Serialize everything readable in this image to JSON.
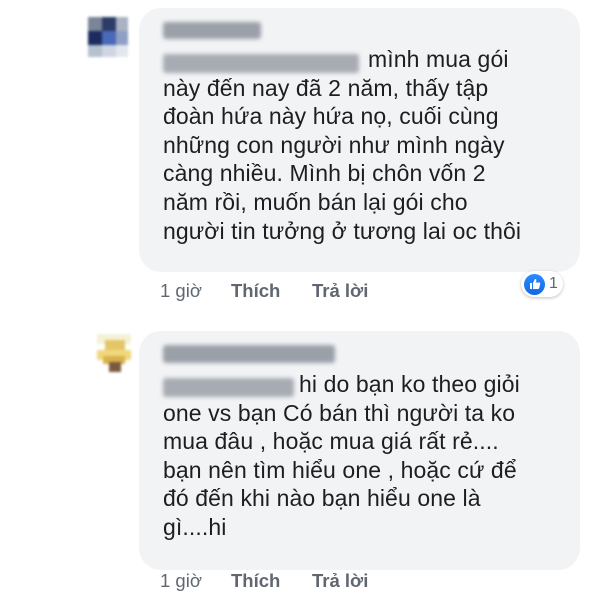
{
  "comments": [
    {
      "lines": [
        "mình mua gói",
        "này đến nay đã 2 năm, thấy tập",
        "đoàn hứa này hứa nọ, cuối cùng",
        "những con người như mình ngày",
        "càng nhiều. Mình bị chôn vốn 2",
        "năm rồi, muốn bán lại gói cho",
        "người tin tưởng ở tương lai oc thôi"
      ],
      "time": "1 giờ",
      "like_label": "Thích",
      "reply_label": "Trả lời",
      "reaction_count": "1",
      "reaction_icon": "like-icon",
      "colors": {
        "like": "#1877f2"
      }
    },
    {
      "lines": [
        "hi do bạn ko theo giỏi",
        "one vs bạn Có bán thì người ta ko",
        "mua đâu , hoặc mua giá rất rẻ....",
        "bạn nên tìm hiểu one , hoặc cứ để",
        "đó đến khi nào bạn hiểu one là",
        "gì....hi"
      ],
      "time": "1 giờ",
      "like_label": "Thích",
      "reply_label": "Trả lời"
    }
  ],
  "colors": {
    "bubble": "#f2f3f5",
    "meta_text": "#606770",
    "body_text": "#1c1e21"
  }
}
